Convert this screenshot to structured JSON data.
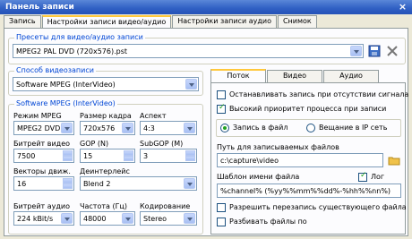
{
  "window": {
    "title": "Панель записи"
  },
  "tabs": [
    "Запись",
    "Настройки записи видео/аудио",
    "Настройки записи аудио",
    "Снимок"
  ],
  "presets": {
    "legend": "Пресеты для видео/аудио записи",
    "value": "MPEG2 PAL DVD (720x576).pst"
  },
  "capture_method": {
    "legend": "Способ видеозаписи",
    "value": "Software MPEG (InterVideo)"
  },
  "mpeg": {
    "legend": "Software MPEG (InterVideo)",
    "mode_label": "Режим MPEG",
    "mode_value": "MPEG2 DVD",
    "frame_label": "Размер кадра",
    "frame_value": "720x576",
    "aspect_label": "Аспект",
    "aspect_value": "4:3",
    "vbitrate_label": "Битрейт видео",
    "vbitrate_value": "7500",
    "gop_label": "GOP (N)",
    "gop_value": "15",
    "subgop_label": "SubGOP (M)",
    "subgop_value": "3",
    "vectors_label": "Векторы движ.",
    "vectors_value": "16",
    "deinterlace_label": "Деинтерлейс",
    "deinterlace_value": "Blend 2",
    "abitrate_label": "Битрейт аудио",
    "abitrate_value": "224 kBit/s",
    "freq_label": "Частота (Гц)",
    "freq_value": "48000",
    "coding_label": "Кодирование",
    "coding_value": "Stereo"
  },
  "right_tabs": [
    "Поток",
    "Видео",
    "Аудио"
  ],
  "stream": {
    "stop_no_signal": "Останавливать запись при отсутствии сигнала",
    "high_priority": "Высокий приоритет процесса при записи",
    "to_file": "Запись в файл",
    "to_ip": "Вещание в IP сеть",
    "path_label": "Путь для записываемых файлов",
    "path_value": "c:\\capture\\video",
    "template_label": "Шаблон имени файла",
    "log_label": "Лог",
    "template_value": "%channel% (%yy%%mm%%dd%-%hh%%nn%)",
    "overwrite": "Разрешить перезапись существующего файла",
    "split": "Разбивать файлы по"
  },
  "colors": {
    "accent": "#0046d5",
    "titlebar": "#2f5fc3",
    "tab_highlight": "#ffc83c",
    "check": "#21a121"
  },
  "icons": [
    "close-icon",
    "save-icon",
    "delete-icon",
    "folder-icon",
    "chevron-down-icon"
  ]
}
